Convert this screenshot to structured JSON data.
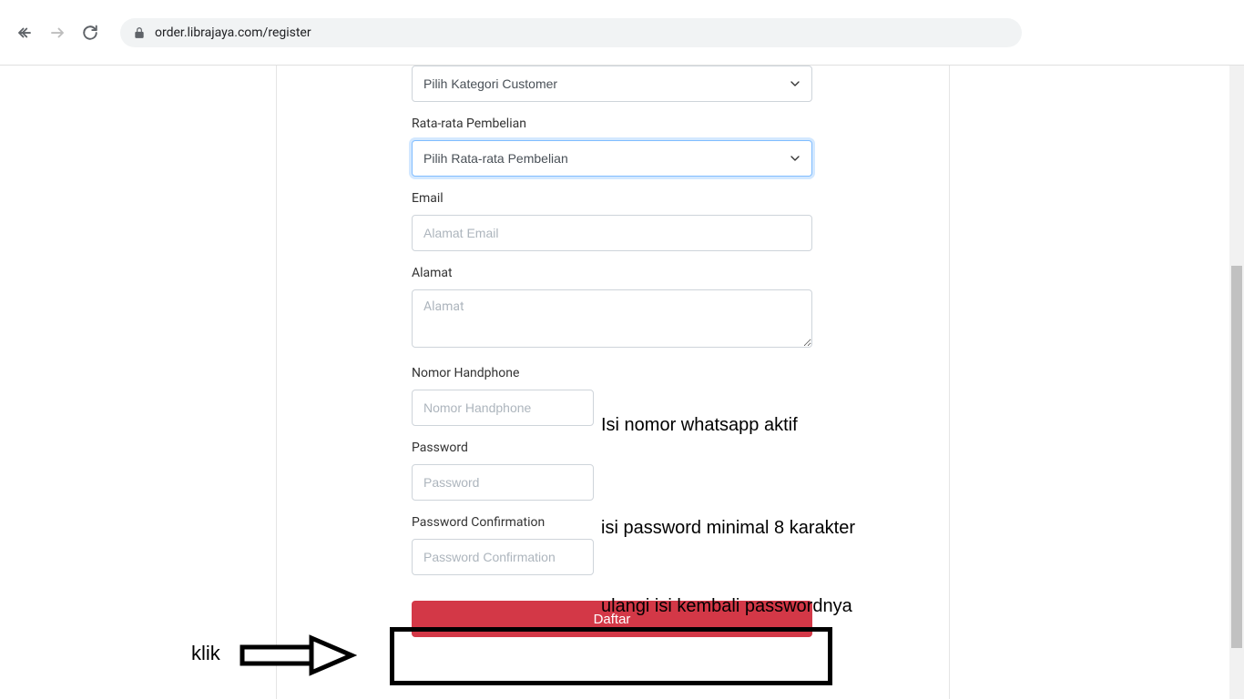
{
  "browser": {
    "url": "order.librajaya.com/register"
  },
  "form": {
    "category": {
      "selected": "Pilih Kategori Customer"
    },
    "purchase": {
      "label": "Rata-rata Pembelian",
      "selected": "Pilih Rata-rata Pembelian"
    },
    "email": {
      "label": "Email",
      "placeholder": "Alamat Email"
    },
    "address": {
      "label": "Alamat",
      "placeholder": "Alamat"
    },
    "phone": {
      "label": "Nomor Handphone",
      "placeholder": "Nomor Handphone"
    },
    "password": {
      "label": "Password",
      "placeholder": "Password"
    },
    "passwordConfirm": {
      "label": "Password Confirmation",
      "placeholder": "Password Confirmation"
    },
    "submit": "Daftar"
  },
  "annotations": {
    "phone": "Isi nomor whatsapp aktif",
    "password": "isi password minimal 8 karakter",
    "confirm": "ulangi isi kembali passwordnya",
    "klik": "klik"
  }
}
